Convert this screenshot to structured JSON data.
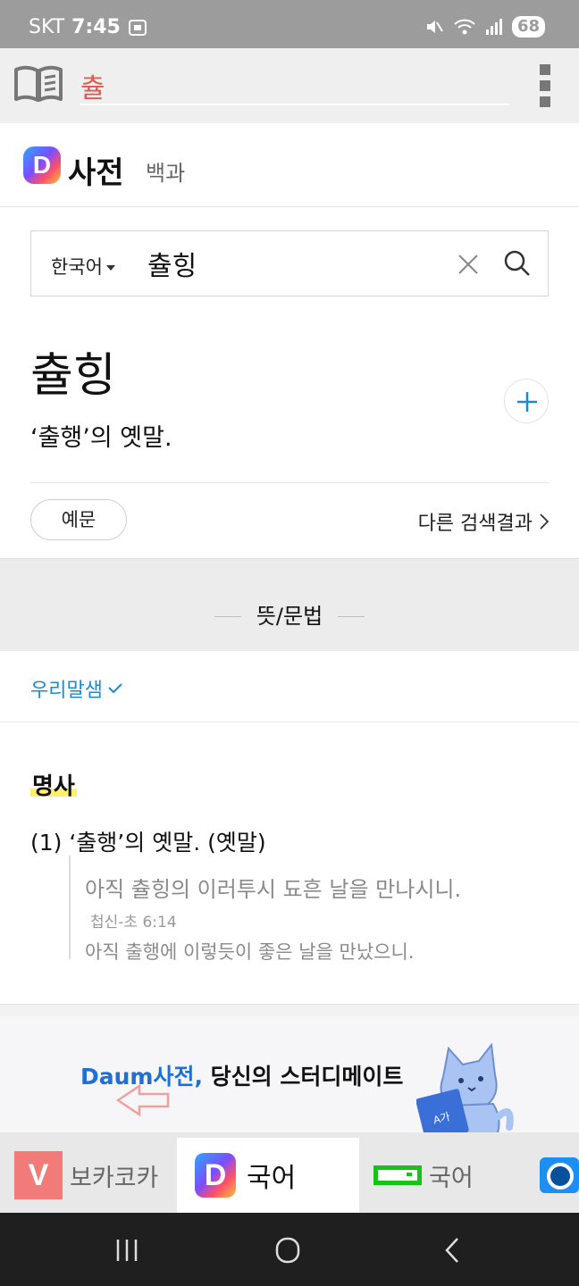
{
  "status_bar": {
    "carrier": "SKT",
    "time": "7:45",
    "battery": "68"
  },
  "app_bar": {
    "query": "츌"
  },
  "brand": {
    "logo_letter": "D",
    "name": "사전",
    "tab_encyclopedia": "백과"
  },
  "search": {
    "language": "한국어",
    "value": "츌힝"
  },
  "entry": {
    "word": "츌힝",
    "summary": "‘출행’의 옛말.",
    "example_button": "예문",
    "other_results": "다른 검색결과"
  },
  "section": {
    "title": "뜻/문법"
  },
  "source": {
    "label": "우리말샘"
  },
  "definition": {
    "part_of_speech": "명사",
    "sense": "(1) ‘출행’의 옛말. (옛말)",
    "example_old": "아직 츌힝의 이러투시 됴흔 날을 만나시니.",
    "example_source": "첩신-초 6:14",
    "example_modern": "아직 출행에 이렇듯이 좋은 날을 만났으니."
  },
  "promo": {
    "brand": "Daum사전,",
    "text": " 당신의 스터디메이트"
  },
  "tabs": {
    "vocab_badge": "V",
    "vocab_label": "보카코카",
    "daum_badge": "D",
    "daum_label": "국어",
    "naver_label": "국어"
  },
  "colors": {
    "accent_blue": "#1a8ad6",
    "query_red": "#e05a4f",
    "highlight_yellow": "#fff06a"
  }
}
